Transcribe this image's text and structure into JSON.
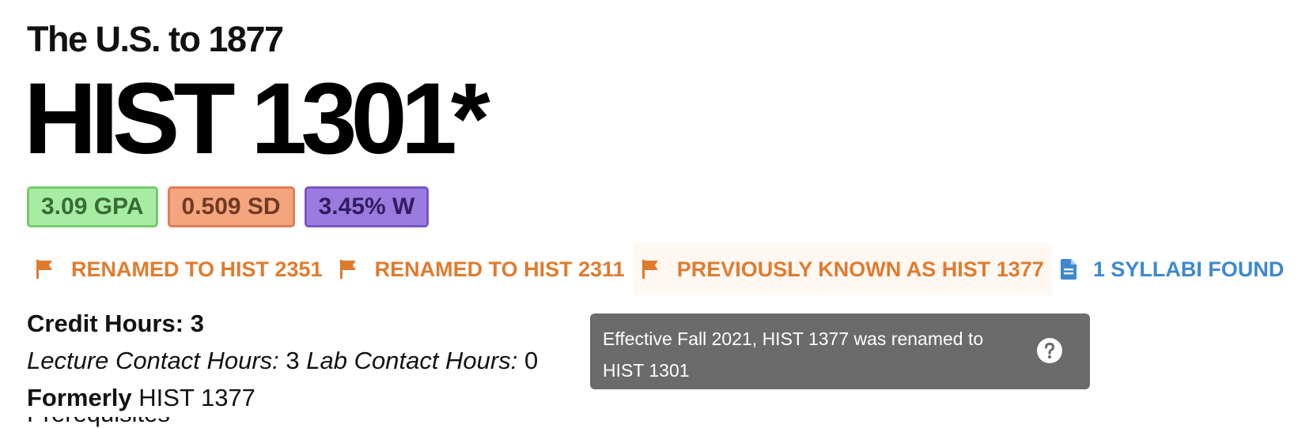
{
  "course": {
    "title": "The U.S. to 1877",
    "code": "HIST 1301*"
  },
  "stats": {
    "gpa": "3.09 GPA",
    "sd": "0.509 SD",
    "withdraw": "3.45% W",
    "colors": {
      "gpa_bg": "#a6eda3",
      "sd_bg": "#f4a57e",
      "w_bg": "#9b7be0"
    }
  },
  "tags": {
    "items": [
      {
        "label": "RENAMED TO HIST 2351",
        "icon": "flag-icon",
        "color": "#e07b2e"
      },
      {
        "label": "RENAMED TO HIST 2311",
        "icon": "flag-icon",
        "color": "#e07b2e"
      },
      {
        "label": "PREVIOUSLY KNOWN AS HIST 1377",
        "icon": "flag-icon",
        "color": "#e07b2e"
      },
      {
        "label": "1 SYLLABI FOUND",
        "icon": "document-icon",
        "color": "#3e88cf"
      }
    ]
  },
  "details": {
    "credit_hours_label": "Credit Hours:",
    "credit_hours_value": "3",
    "lecture_label": "Lecture Contact Hours:",
    "lecture_value": "3",
    "lab_label": "Lab Contact Hours:",
    "lab_value": "0",
    "formerly_label": "Formerly",
    "formerly_value": "HIST 1377",
    "next_line_partial": "Prerequisites"
  },
  "tooltip": {
    "text": "Effective Fall 2021, HIST 1377 was renamed to HIST 1301",
    "icon": "help-icon"
  }
}
